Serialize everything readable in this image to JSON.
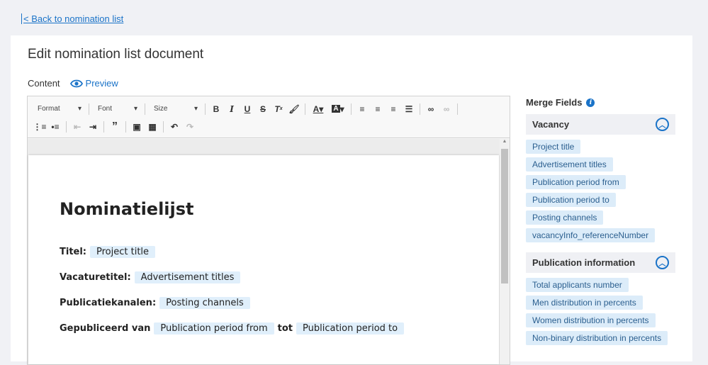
{
  "back_link": "< Back to nomination list",
  "title": "Edit nomination list document",
  "tabs": {
    "content": "Content",
    "preview": "Preview"
  },
  "toolbar": {
    "format": "Format",
    "font": "Font",
    "size": "Size"
  },
  "document": {
    "heading": "Nominatielijst",
    "lines": [
      {
        "label": "Titel:",
        "fields": [
          "Project title"
        ]
      },
      {
        "label": "Vacaturetitel:",
        "fields": [
          "Advertisement titles"
        ]
      },
      {
        "label": "Publicatiekanalen:",
        "fields": [
          "Posting channels"
        ]
      },
      {
        "label": "Gepubliceerd van",
        "fields": [
          "Publication period from"
        ],
        "mid": "tot",
        "fields2": [
          "Publication period to"
        ]
      }
    ]
  },
  "merge_fields": {
    "title": "Merge Fields",
    "sections": [
      {
        "name": "Vacancy",
        "fields": [
          "Project title",
          "Advertisement titles",
          "Publication period from",
          "Publication period to",
          "Posting channels",
          "vacancyInfo_referenceNumber"
        ]
      },
      {
        "name": "Publication information",
        "fields": [
          "Total applicants number",
          "Men distribution in percents",
          "Women distribution in percents",
          "Non-binary distribution in percents"
        ]
      }
    ]
  }
}
